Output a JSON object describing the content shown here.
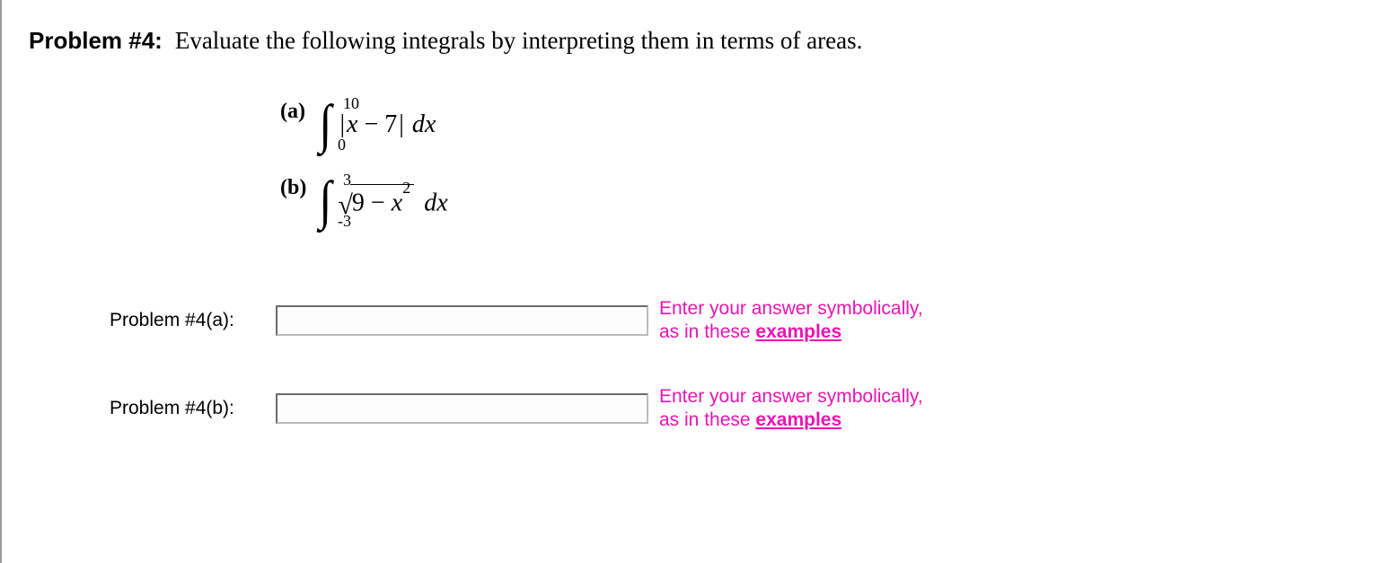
{
  "problem": {
    "label": "Problem #4:",
    "instruction": "Evaluate the following integrals by interpreting them in terms of areas."
  },
  "parts": {
    "a": {
      "label": "(a)",
      "upper": "10",
      "lower": "0",
      "expr_abs_open": "|",
      "expr_var": "x",
      "expr_op": " − ",
      "expr_const": "7",
      "expr_abs_close": "|",
      "dx": " dx"
    },
    "b": {
      "label": "(b)",
      "upper": "3",
      "lower": "-3",
      "rad_const": "9",
      "rad_op": " − ",
      "rad_var": "x",
      "rad_exp": "2",
      "dx": " dx"
    }
  },
  "answers": {
    "a": {
      "label": "Problem #4(a):",
      "value": "",
      "hint_line1": "Enter your answer symbolically,",
      "hint_line2_prefix": "as in these ",
      "hint_link": "examples"
    },
    "b": {
      "label": "Problem #4(b):",
      "value": "",
      "hint_line1": "Enter your answer symbolically,",
      "hint_line2_prefix": "as in these ",
      "hint_link": "examples"
    }
  }
}
